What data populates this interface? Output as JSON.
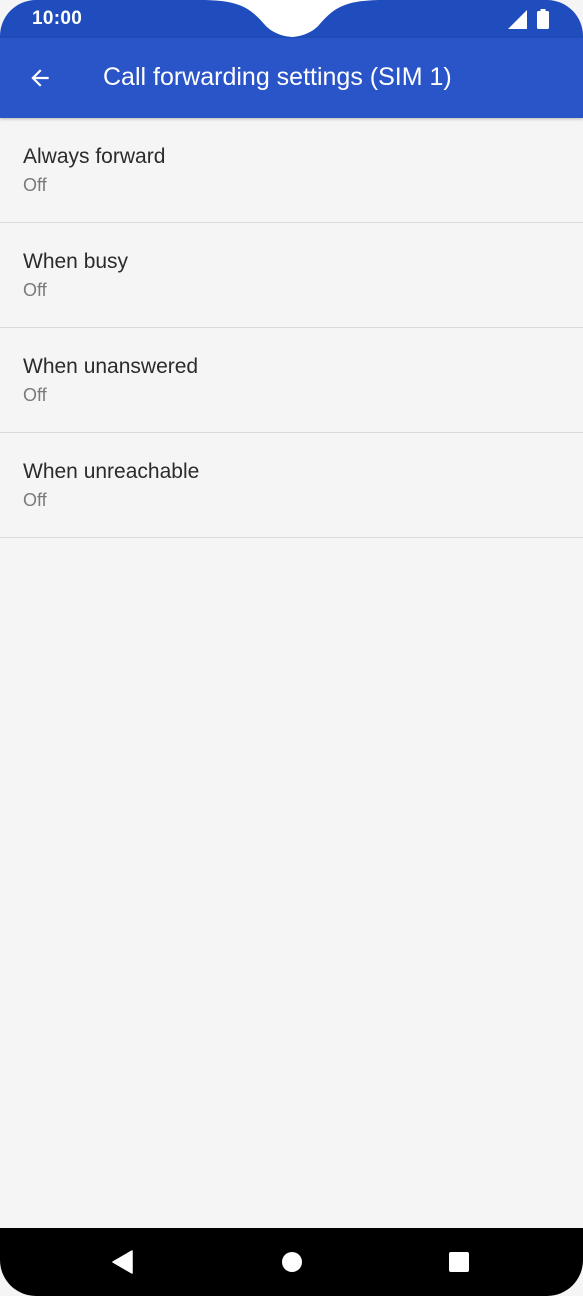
{
  "status_bar": {
    "time": "10:00",
    "icons": [
      "signal-icon",
      "battery-icon"
    ]
  },
  "app_bar": {
    "back_icon": "arrow-back-icon",
    "title": "Call forwarding settings (SIM 1)"
  },
  "settings": {
    "items": [
      {
        "title": "Always forward",
        "summary": "Off"
      },
      {
        "title": "When busy",
        "summary": "Off"
      },
      {
        "title": "When unanswered",
        "summary": "Off"
      },
      {
        "title": "When unreachable",
        "summary": "Off"
      }
    ]
  },
  "nav_bar": {
    "icons": [
      "back-triangle-icon",
      "home-circle-icon",
      "recents-square-icon"
    ]
  },
  "colors": {
    "status_bar": "#1f4dbd",
    "app_bar": "#2a55c8",
    "background": "#f5f5f5",
    "nav_bar": "#000000"
  }
}
